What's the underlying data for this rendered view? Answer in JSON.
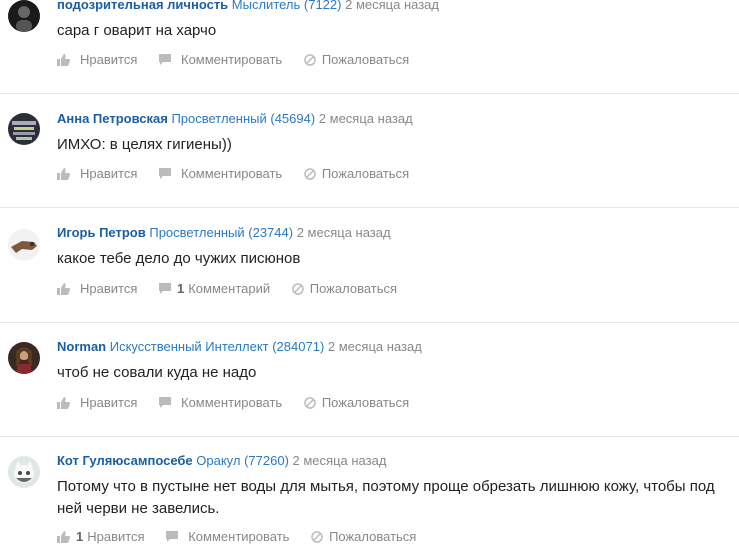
{
  "answers": [
    {
      "author": "подозрительная личность",
      "rank": "Мыслитель (7122)",
      "time": "2 месяца назад",
      "text": "сара г оварит на харчо",
      "like": "Нравится",
      "like_count": "",
      "comment": "Комментировать",
      "comment_count": "",
      "report": "Пожаловаться"
    },
    {
      "author": "Анна Петровская",
      "rank": "Просветленный (45694)",
      "time": "2 месяца назад",
      "text": "ИМХО: в целях гигиены))",
      "like": "Нравится",
      "like_count": "",
      "comment": "Комментировать",
      "comment_count": "",
      "report": "Пожаловаться"
    },
    {
      "author": "Игорь Петров",
      "rank": "Просветленный (23744)",
      "time": "2 месяца назад",
      "text": "какое тебе дело до чужих писюнов",
      "like": "Нравится",
      "like_count": "",
      "comment": "Комментарий",
      "comment_count": "1",
      "report": "Пожаловаться"
    },
    {
      "author": "Norman",
      "rank": "Искусственный Интеллект (284071)",
      "time": "2 месяца назад",
      "text": "чтоб не совали куда не надо",
      "like": "Нравится",
      "like_count": "",
      "comment": "Комментировать",
      "comment_count": "",
      "report": "Пожаловаться"
    },
    {
      "author": "Кот Гуляюсампосебе",
      "rank": "Оракул (77260)",
      "time": "2 месяца назад",
      "text": "Потому что в пустыне нет воды для мытья, поэтому проще обрезать лишнюю кожу, чтобы под ней черви не завелись.",
      "like": "Нравится",
      "like_count": "1",
      "comment": "Комментировать",
      "comment_count": "",
      "report": "Пожаловаться"
    }
  ]
}
